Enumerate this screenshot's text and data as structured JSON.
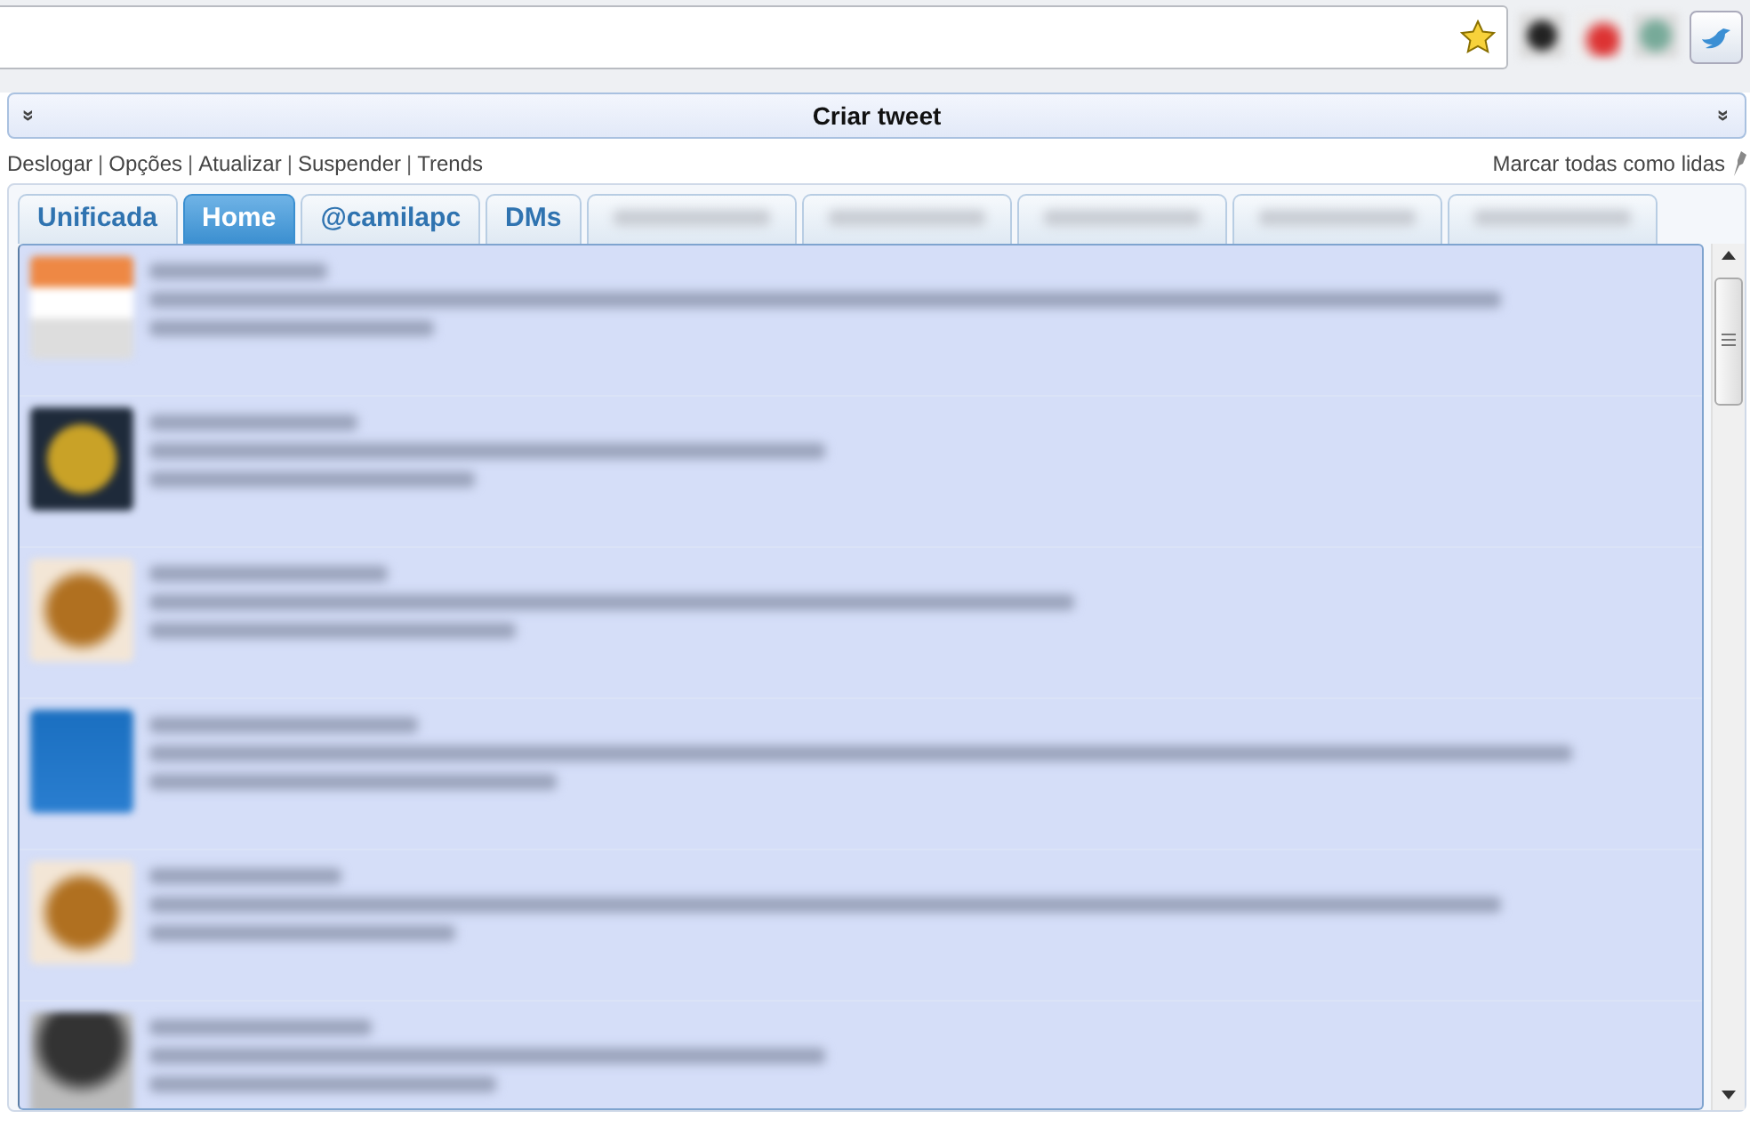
{
  "browser": {
    "bookmark_starred": true
  },
  "compose_bar": {
    "title": "Criar tweet",
    "expand_left": "»",
    "expand_right": "»"
  },
  "menu_links": [
    {
      "kind": "link",
      "label": "Deslogar"
    },
    {
      "kind": "separator",
      "label": "|"
    },
    {
      "kind": "link",
      "label": "Opções"
    },
    {
      "kind": "separator",
      "label": "|"
    },
    {
      "kind": "link",
      "label": "Atualizar"
    },
    {
      "kind": "separator",
      "label": "|"
    },
    {
      "kind": "link",
      "label": "Suspender"
    },
    {
      "kind": "separator",
      "label": "|"
    },
    {
      "kind": "link",
      "label": "Trends"
    }
  ],
  "mark_all_read": "Marcar todas como lidas",
  "tabs": [
    {
      "kind": "text",
      "label": "Unificada",
      "selected": false
    },
    {
      "kind": "text",
      "label": "Home",
      "selected": true
    },
    {
      "kind": "text",
      "label": "@camilapc",
      "selected": false
    },
    {
      "kind": "text",
      "label": "DMs",
      "selected": false
    },
    {
      "kind": "blurred",
      "selected": false
    },
    {
      "kind": "blurred",
      "selected": false
    },
    {
      "kind": "blurred",
      "selected": false
    },
    {
      "kind": "blurred",
      "selected": false
    },
    {
      "kind": "blurred",
      "selected": false
    }
  ],
  "tweets": [
    {
      "unread": true
    },
    {
      "unread": true
    },
    {
      "unread": true
    },
    {
      "unread": true
    },
    {
      "unread": true
    },
    {
      "unread": true
    }
  ]
}
